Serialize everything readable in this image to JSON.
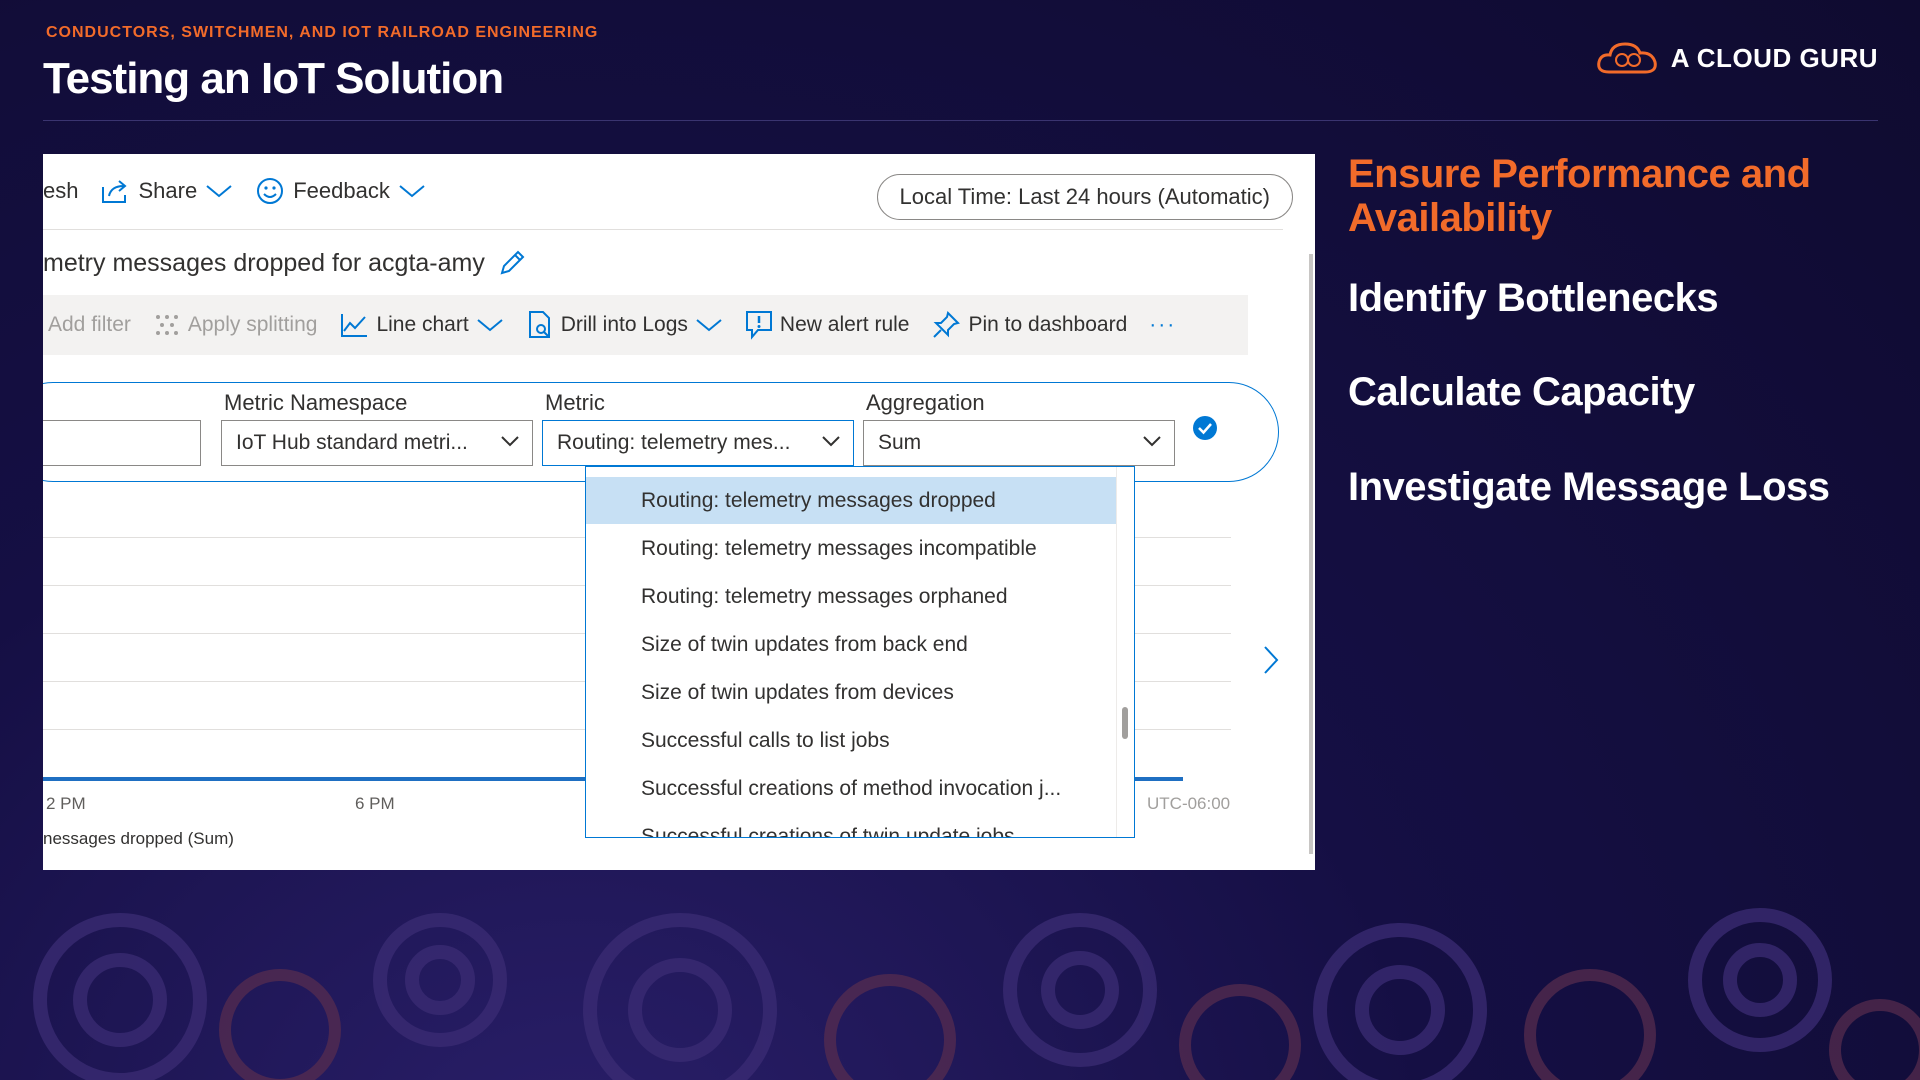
{
  "slide": {
    "eyebrow": "CONDUCTORS, SWITCHMEN, AND IOT RAILROAD ENGINEERING",
    "title": "Testing an IoT Solution",
    "brand": "A CLOUD GURU",
    "accent_color": "#f26b2a",
    "background_color": "#120f3a"
  },
  "bullets": {
    "accent": "Ensure Performance and Availability",
    "items": [
      "Identify Bottlenecks",
      "Calculate Capacity",
      "Investigate Message Loss"
    ]
  },
  "azure": {
    "toolbar": {
      "refresh": "esh",
      "share": "Share",
      "feedback": "Feedback",
      "time_range": "Local Time: Last 24 hours (Automatic)"
    },
    "chart_title": "metry messages dropped for acgta-amy",
    "commands": {
      "add_filter": "Add filter",
      "apply_splitting": "Apply splitting",
      "line_chart": "Line chart",
      "drill_logs": "Drill into Logs",
      "new_alert": "New alert rule",
      "pin": "Pin to dashboard",
      "more": "···"
    },
    "fields": {
      "namespace_label": "Metric Namespace",
      "namespace_value": "IoT Hub standard metri...",
      "metric_label": "Metric",
      "metric_value": "Routing: telemetry mes...",
      "aggregation_label": "Aggregation",
      "aggregation_value": "Sum"
    },
    "dropdown_options": [
      "Routing: telemetry messages dropped",
      "Routing: telemetry messages incompatible",
      "Routing: telemetry messages orphaned",
      "Size of twin updates from back end",
      "Size of twin updates from devices",
      "Successful calls to list jobs",
      "Successful creations of method invocation j...",
      "Successful creations of twin update jobs"
    ],
    "selected_option_index": 0,
    "x_ticks": [
      "2 PM",
      "6 PM",
      "UTC-06:00"
    ],
    "legend": "nessages dropped (Sum)",
    "azure_blue": "#0078d4"
  }
}
